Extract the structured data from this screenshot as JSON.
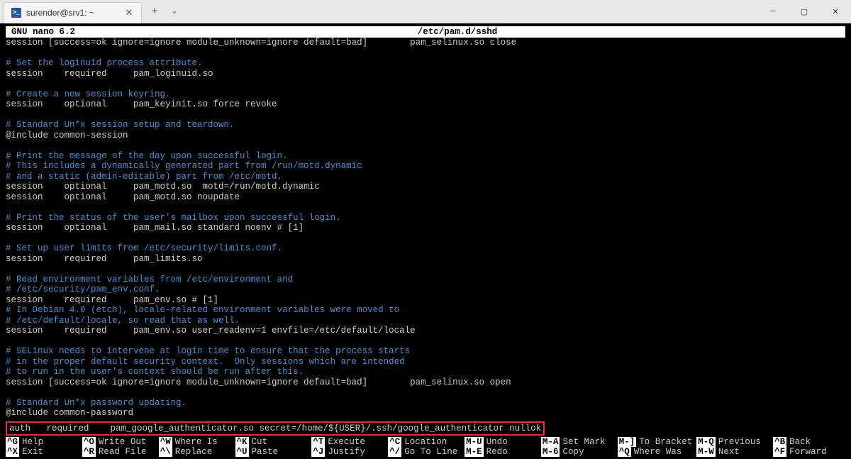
{
  "titlebar": {
    "tab_title": "surender@srv1: ~",
    "tab_icon_text": ">_"
  },
  "nano": {
    "version": "GNU nano 6.2",
    "file": "/etc/pam.d/sshd"
  },
  "lines": [
    {
      "t": "plain",
      "text": "session [success=ok ignore=ignore module_unknown=ignore default=bad]        pam_selinux.so close"
    },
    {
      "t": "blank",
      "text": ""
    },
    {
      "t": "comment",
      "text": "# Set the loginuid process attribute."
    },
    {
      "t": "plain",
      "text": "session    required     pam_loginuid.so"
    },
    {
      "t": "blank",
      "text": ""
    },
    {
      "t": "comment",
      "text": "# Create a new session keyring."
    },
    {
      "t": "plain",
      "text": "session    optional     pam_keyinit.so force revoke"
    },
    {
      "t": "blank",
      "text": ""
    },
    {
      "t": "comment",
      "text": "# Standard Un*x session setup and teardown."
    },
    {
      "t": "plain",
      "text": "@include common-session"
    },
    {
      "t": "blank",
      "text": ""
    },
    {
      "t": "comment",
      "text": "# Print the message of the day upon successful login."
    },
    {
      "t": "comment",
      "text": "# This includes a dynamically generated part from /run/motd.dynamic"
    },
    {
      "t": "comment",
      "text": "# and a static (admin-editable) part from /etc/motd."
    },
    {
      "t": "plain",
      "text": "session    optional     pam_motd.so  motd=/run/motd.dynamic"
    },
    {
      "t": "plain",
      "text": "session    optional     pam_motd.so noupdate"
    },
    {
      "t": "blank",
      "text": ""
    },
    {
      "t": "comment",
      "text": "# Print the status of the user's mailbox upon successful login."
    },
    {
      "t": "plain",
      "text": "session    optional     pam_mail.so standard noenv # [1]"
    },
    {
      "t": "blank",
      "text": ""
    },
    {
      "t": "comment",
      "text": "# Set up user limits from /etc/security/limits.conf."
    },
    {
      "t": "plain",
      "text": "session    required     pam_limits.so"
    },
    {
      "t": "blank",
      "text": ""
    },
    {
      "t": "comment",
      "text": "# Read environment variables from /etc/environment and"
    },
    {
      "t": "comment",
      "text": "# /etc/security/pam_env.conf."
    },
    {
      "t": "plain",
      "text": "session    required     pam_env.so # [1]"
    },
    {
      "t": "comment",
      "text": "# In Debian 4.0 (etch), locale-related environment variables were moved to"
    },
    {
      "t": "comment",
      "text": "# /etc/default/locale, so read that as well."
    },
    {
      "t": "plain",
      "text": "session    required     pam_env.so user_readenv=1 envfile=/etc/default/locale"
    },
    {
      "t": "blank",
      "text": ""
    },
    {
      "t": "comment",
      "text": "# SELinux needs to intervene at login time to ensure that the process starts"
    },
    {
      "t": "comment",
      "text": "# in the proper default security context.  Only sessions which are intended"
    },
    {
      "t": "comment",
      "text": "# to run in the user's context should be run after this."
    },
    {
      "t": "plain",
      "text": "session [success=ok ignore=ignore module_unknown=ignore default=bad]        pam_selinux.so open"
    },
    {
      "t": "blank",
      "text": ""
    },
    {
      "t": "comment",
      "text": "# Standard Un*x password updating."
    },
    {
      "t": "plain",
      "text": "@include common-password"
    }
  ],
  "highlighted_line": "auth   required    pam_google_authenticator.so secret=/home/${USER}/.ssh/google_authenticator nullok",
  "shortcuts": {
    "row1": [
      {
        "key": "^G",
        "desc": "Help"
      },
      {
        "key": "^O",
        "desc": "Write Out"
      },
      {
        "key": "^W",
        "desc": "Where Is"
      },
      {
        "key": "^K",
        "desc": "Cut"
      },
      {
        "key": "^T",
        "desc": "Execute"
      },
      {
        "key": "^C",
        "desc": "Location"
      },
      {
        "key": "M-U",
        "desc": "Undo"
      },
      {
        "key": "M-A",
        "desc": "Set Mark"
      },
      {
        "key": "M-]",
        "desc": "To Bracket"
      },
      {
        "key": "M-Q",
        "desc": "Previous"
      },
      {
        "key": "^B",
        "desc": "Back"
      }
    ],
    "row2": [
      {
        "key": "^X",
        "desc": "Exit"
      },
      {
        "key": "^R",
        "desc": "Read File"
      },
      {
        "key": "^\\",
        "desc": "Replace"
      },
      {
        "key": "^U",
        "desc": "Paste"
      },
      {
        "key": "^J",
        "desc": "Justify"
      },
      {
        "key": "^/",
        "desc": "Go To Line"
      },
      {
        "key": "M-E",
        "desc": "Redo"
      },
      {
        "key": "M-6",
        "desc": "Copy"
      },
      {
        "key": "^Q",
        "desc": "Where Was"
      },
      {
        "key": "M-W",
        "desc": "Next"
      },
      {
        "key": "^F",
        "desc": "Forward"
      }
    ]
  }
}
